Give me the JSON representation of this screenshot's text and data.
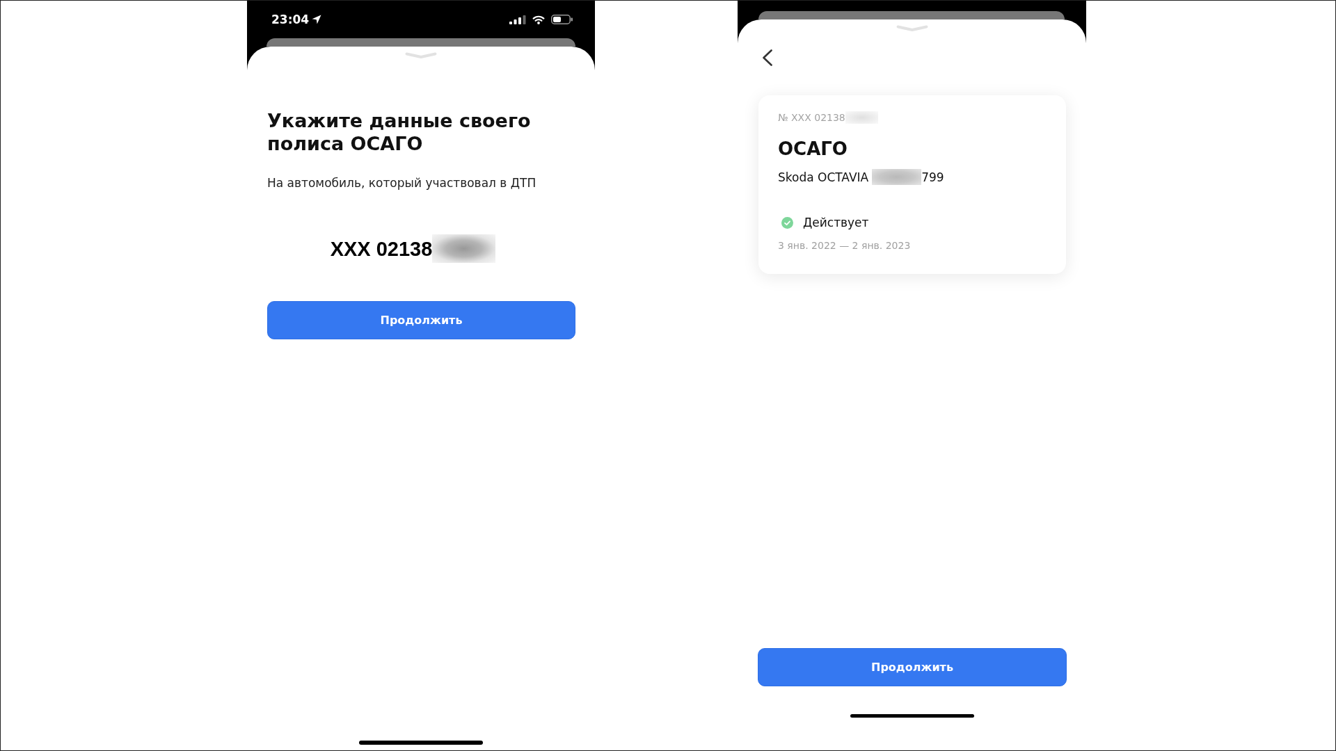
{
  "screens": [
    {
      "kind": "entry",
      "status_bar": {
        "time": "23:04"
      },
      "title": "Укажите данные своего полиса ОСАГО",
      "subtitle": "На автомобиль, который участвовал в ДТП",
      "policy_number": "XXX 02138",
      "button": "Продолжить"
    },
    {
      "kind": "summary",
      "policy_card": {
        "number": "№ XXX 02138",
        "type": "ОСАГО",
        "vehicle": "Skoda OCTAVIA",
        "plate": "799",
        "status": "Действует",
        "period": "3 янв. 2022 — 2 янв. 2023"
      },
      "button": "Продолжить"
    }
  ]
}
